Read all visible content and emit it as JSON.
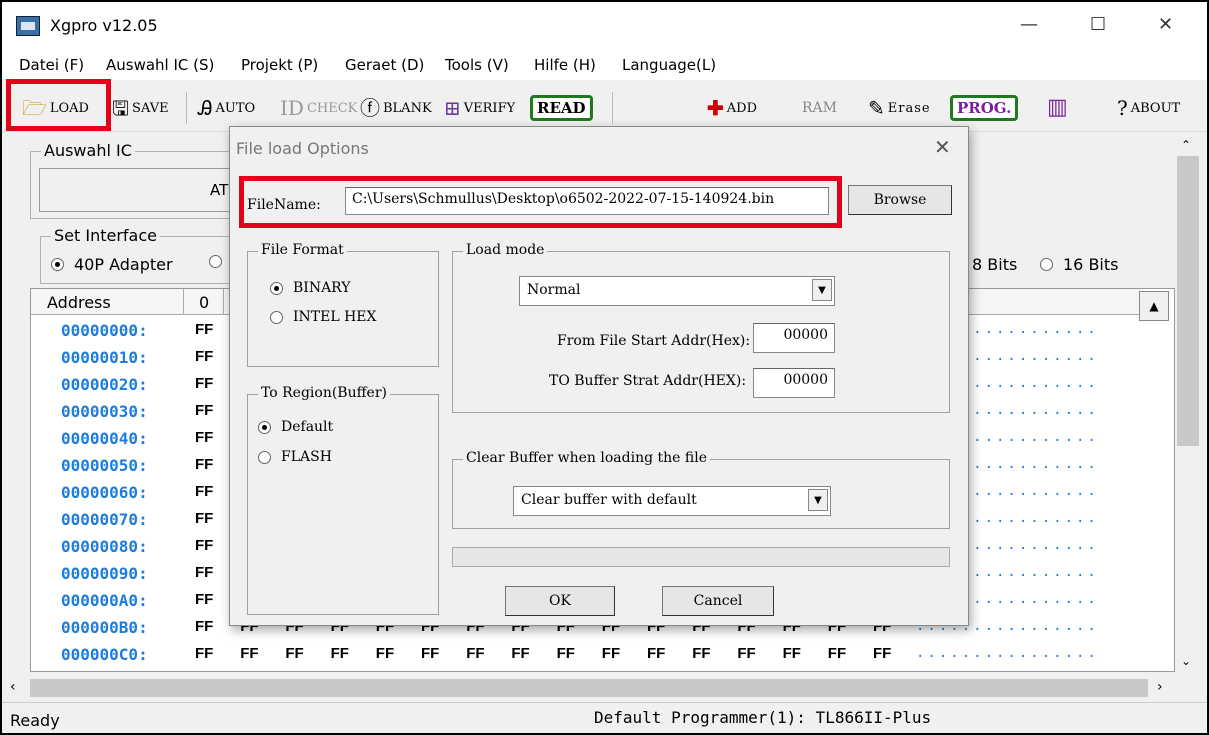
{
  "window": {
    "title": "Xgpro v12.05",
    "controls": {
      "minimize": "—",
      "maximize": "☐",
      "close": "✕"
    }
  },
  "menu": [
    "Datei (F)",
    "Auswahl IC (S)",
    "Projekt (P)",
    "Geraet (D)",
    "Tools (V)",
    "Hilfe (H)",
    "Language(L)"
  ],
  "toolbar": {
    "load": "LOAD",
    "save": "SAVE",
    "auto": "AUTO",
    "check": "CHECK",
    "blank": "BLANK",
    "verify": "VERIFY",
    "read": "READ",
    "add": "ADD",
    "ram": "RAM",
    "erase": "Erase",
    "prog": "PROG.",
    "about": "ABOUT"
  },
  "main": {
    "auswahl_ic_label": "Auswahl IC",
    "chip_partial": "AT",
    "set_interface_label": "Set Interface",
    "adapter_40p": "40P Adapter",
    "bits8": "8 Bits",
    "bits16": "16 Bits"
  },
  "hex": {
    "header_address": "Address",
    "header_col0": "0",
    "rows": [
      {
        "addr": "00000000:",
        "val": "FF"
      },
      {
        "addr": "00000010:",
        "val": "FF"
      },
      {
        "addr": "00000020:",
        "val": "FF"
      },
      {
        "addr": "00000030:",
        "val": "FF"
      },
      {
        "addr": "00000040:",
        "val": "FF"
      },
      {
        "addr": "00000050:",
        "val": "FF"
      },
      {
        "addr": "00000060:",
        "val": "FF"
      },
      {
        "addr": "00000070:",
        "val": "FF"
      },
      {
        "addr": "00000080:",
        "val": "FF"
      },
      {
        "addr": "00000090:",
        "val": "FF"
      },
      {
        "addr": "000000A0:",
        "val": "FF"
      },
      {
        "addr": "000000B0:",
        "val": "FF"
      },
      {
        "addr": "000000C0:",
        "val": "FF"
      }
    ],
    "ascii_dots": "................"
  },
  "status": {
    "left": "Ready",
    "programmer": "Default Programmer(1): TL866II-Plus"
  },
  "dialog": {
    "title": "File load Options",
    "close": "✕",
    "filename_label": "FileName:",
    "filename_value": "C:\\Users\\Schmullus\\Desktop\\o6502-2022-07-15-140924.bin",
    "browse": "Browse",
    "file_format_label": "File Format",
    "binary": "BINARY",
    "intel_hex": "INTEL HEX",
    "region_label": "To Region(Buffer)",
    "default": "Default",
    "flash": "FLASH",
    "load_mode_label": "Load mode",
    "load_mode_value": "Normal",
    "from_addr_label": "From File Start Addr(Hex):",
    "from_addr_value": "00000",
    "to_addr_label": "TO Buffer Strat Addr(HEX):",
    "to_addr_value": "00000",
    "clear_label": "Clear Buffer when loading the file",
    "clear_value": "Clear buffer with default",
    "ok": "OK",
    "cancel": "Cancel"
  }
}
